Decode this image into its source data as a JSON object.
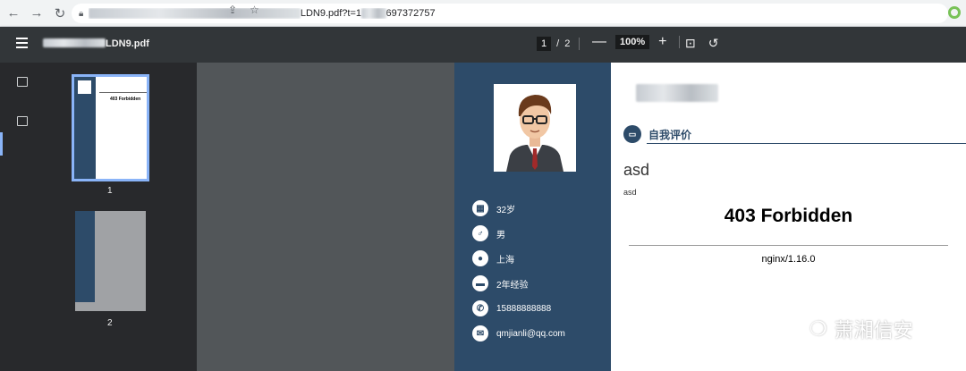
{
  "browser": {
    "url_visible_part": "LDN9.pdf?t=1",
    "url_tail": "697372757"
  },
  "pdf": {
    "filename": "LDN9.pdf",
    "page_current": "1",
    "page_sep": "/",
    "page_total": "2",
    "zoom": "100%",
    "zoom_minus": "—",
    "zoom_plus": "+"
  },
  "thumbnails": {
    "page1_label": "1",
    "page2_label": "2",
    "page1_title": "403 Forbidden"
  },
  "resume": {
    "info": [
      {
        "icon": "calendar-icon",
        "glyph": "▦",
        "text": "32岁"
      },
      {
        "icon": "male-icon",
        "glyph": "♂",
        "text": "男"
      },
      {
        "icon": "location-icon",
        "glyph": "●",
        "text": "上海"
      },
      {
        "icon": "briefcase-icon",
        "glyph": "▬",
        "text": "2年经验"
      },
      {
        "icon": "phone-icon",
        "glyph": "✆",
        "text": "15888888888"
      },
      {
        "icon": "mail-icon",
        "glyph": "✉",
        "text": "qmjianli@qq.com"
      }
    ],
    "section_title": "自我评价",
    "asd_large": "asd",
    "asd_small": "asd",
    "error_title": "403 Forbidden",
    "server": "nginx/1.16.0"
  },
  "watermark": {
    "text": "萧湘信安"
  },
  "colors": {
    "sidebar_blue": "#2d4b69",
    "toolbar": "#323639",
    "viewer_bg": "#525659",
    "selected_thumb": "#8ab4f8"
  }
}
